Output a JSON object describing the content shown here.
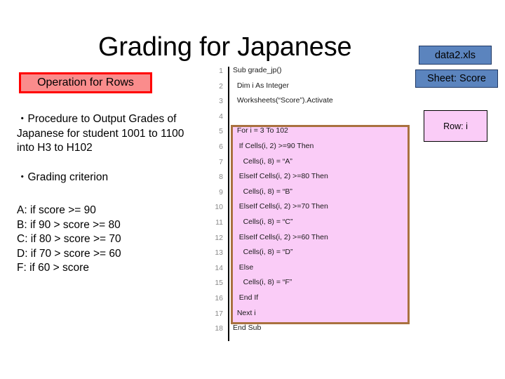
{
  "slide": {
    "title": "Grading for Japanese",
    "section_badge": "Operation for Rows",
    "paragraphs": {
      "procedure": "・Procedure to Output Grades of Japanese for student 1001 to 1100 into H3 to H102",
      "criterion_heading": "・Grading criterion",
      "criteria": [
        "A: if score >= 90",
        "B: if 90 > score >= 80",
        "C: if 80 > score >= 70",
        "D: if 70 > score >= 60",
        "F: if 60 > score"
      ]
    },
    "code": {
      "lines": [
        {
          "n": "1",
          "text": "Sub grade_jp()"
        },
        {
          "n": "2",
          "text": "  Dim i As Integer"
        },
        {
          "n": "3",
          "text": "  Worksheets(“Score”).Activate"
        },
        {
          "n": "4",
          "text": ""
        },
        {
          "n": "5",
          "text": "  For i = 3 To 102"
        },
        {
          "n": "6",
          "text": "   If Cells(i, 2) >=90 Then"
        },
        {
          "n": "7",
          "text": "     Cells(i, 8) = “A”"
        },
        {
          "n": "8",
          "text": "   ElseIf Cells(i, 2) >=80 Then"
        },
        {
          "n": "9",
          "text": "     Cells(i, 8) = “B”"
        },
        {
          "n": "10",
          "text": "   ElseIf Cells(i, 2) >=70 Then"
        },
        {
          "n": "11",
          "text": "     Cells(i, 8) = “C”"
        },
        {
          "n": "12",
          "text": "   ElseIf Cells(i, 2) >=60 Then"
        },
        {
          "n": "13",
          "text": "     Cells(i, 8) = “D”"
        },
        {
          "n": "14",
          "text": "   Else"
        },
        {
          "n": "15",
          "text": "     Cells(i, 8) = “F”"
        },
        {
          "n": "16",
          "text": "   End If"
        },
        {
          "n": "17",
          "text": "  Next i"
        },
        {
          "n": "18",
          "text": "End Sub"
        }
      ],
      "highlight_from_line": 5,
      "highlight_to_line": 17
    },
    "callouts": {
      "file": "data2.xls",
      "sheet": "Sheet: Score",
      "row": "Row: i"
    },
    "colors": {
      "badge_fill": "#FA8C8C",
      "badge_border": "#FF0000",
      "code_highlight_fill": "#FACCF7",
      "code_highlight_border": "#A9713F",
      "callout_blue_fill": "#5B84BE",
      "callout_blue_border": "#1F3864",
      "callout_pink_fill": "#FACCF7",
      "line_number": "#8A8A8A"
    }
  }
}
